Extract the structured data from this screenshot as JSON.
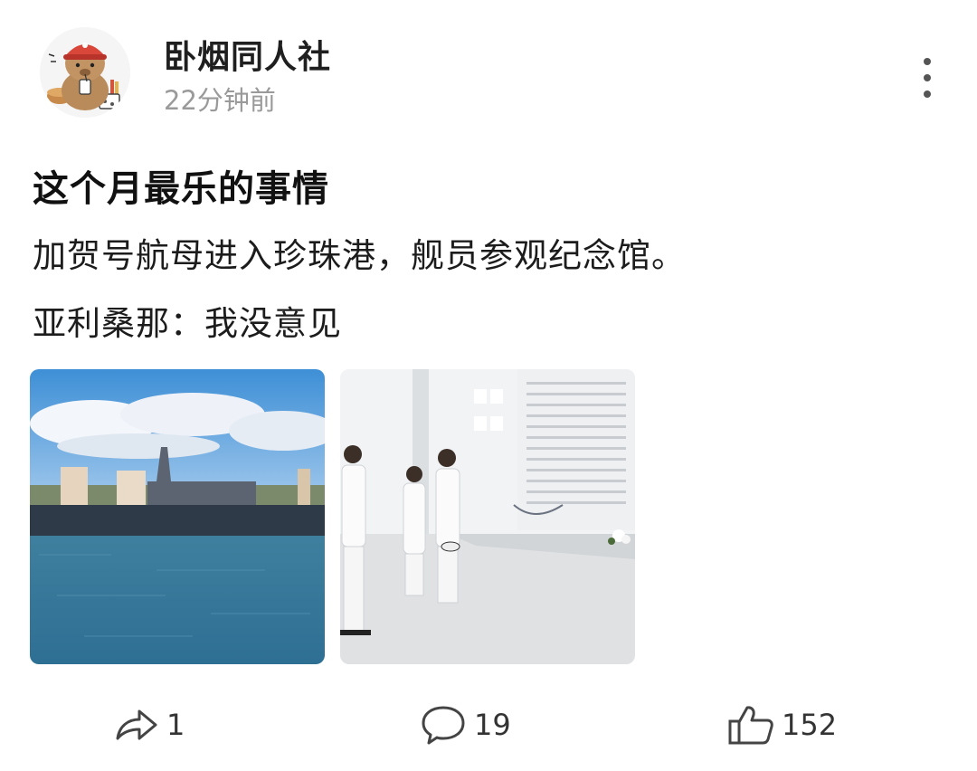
{
  "author": {
    "name": "卧烟同人社",
    "time": "22分钟前"
  },
  "post": {
    "title": "这个月最乐的事情",
    "lines": [
      "加贺号航母进入珍珠港，舰员参观纪念馆。",
      "亚利桑那：我没意见"
    ]
  },
  "images": [
    {
      "icon": "warship-harbor-photo"
    },
    {
      "icon": "memorial-sailors-photo"
    }
  ],
  "actions": {
    "share": {
      "icon": "share-arrow-icon",
      "count": "1"
    },
    "comment": {
      "icon": "comment-bubble-icon",
      "count": "19"
    },
    "like": {
      "icon": "thumbs-up-icon",
      "count": "152"
    }
  }
}
